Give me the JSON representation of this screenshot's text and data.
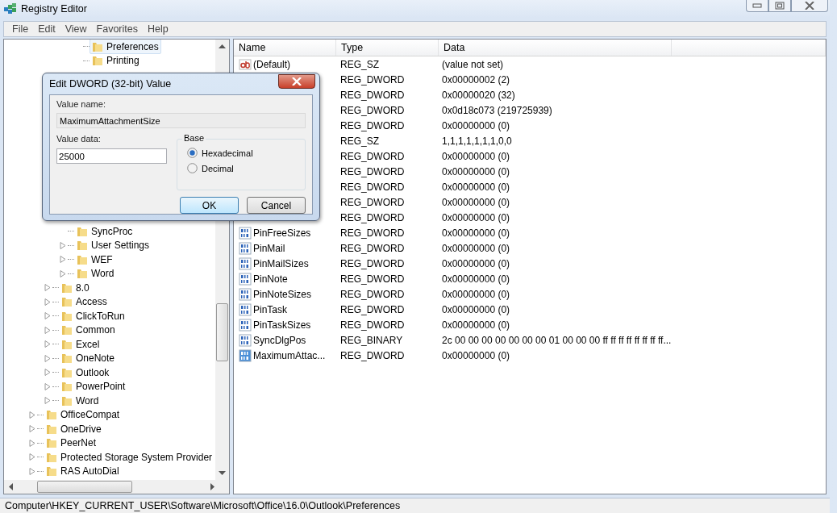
{
  "window": {
    "title": "Registry Editor"
  },
  "menu": [
    "File",
    "Edit",
    "View",
    "Favorites",
    "Help"
  ],
  "tree": {
    "items": [
      {
        "children": [
          {
            "children": [
              {
                "children": [
                  {
                    "label": "Preferences",
                    "selected": true,
                    "expandable": false
                  },
                  {
                    "label": "Printing",
                    "selected": false,
                    "expandable": false
                  }
                ]
              },
              {
                "label": "SyncProc",
                "selected": false,
                "expandable": false
              },
              {
                "label": "User Settings",
                "selected": false,
                "expandable": true
              },
              {
                "label": "WEF",
                "selected": false,
                "expandable": true
              },
              {
                "label": "Word",
                "selected": false,
                "expandable": true
              }
            ]
          },
          {
            "label": "8.0",
            "selected": false,
            "expandable": true
          },
          {
            "label": "Access",
            "selected": false,
            "expandable": true
          },
          {
            "label": "ClickToRun",
            "selected": false,
            "expandable": true
          },
          {
            "label": "Common",
            "selected": false,
            "expandable": true
          },
          {
            "label": "Excel",
            "selected": false,
            "expandable": true
          },
          {
            "label": "OneNote",
            "selected": false,
            "expandable": true
          },
          {
            "label": "Outlook",
            "selected": false,
            "expandable": true
          },
          {
            "label": "PowerPoint",
            "selected": false,
            "expandable": true
          },
          {
            "label": "Word",
            "selected": false,
            "expandable": true
          }
        ]
      },
      {
        "label": "OfficeCompat",
        "selected": false,
        "expandable": true
      },
      {
        "label": "OneDrive",
        "selected": false,
        "expandable": true
      },
      {
        "label": "PeerNet",
        "selected": false,
        "expandable": true
      },
      {
        "label": "Protected Storage System Provider",
        "selected": false,
        "expandable": true
      },
      {
        "label": "RAS AutoDial",
        "selected": false,
        "expandable": true
      }
    ]
  },
  "list": {
    "columns": [
      "Name",
      "Type",
      "Data"
    ],
    "rows": [
      {
        "name": "(Default)",
        "type": "REG_SZ",
        "data": "(value not set)",
        "kind": "string",
        "selected": false
      },
      {
        "type": "REG_DWORD",
        "data": "0x00000002 (2)"
      },
      {
        "type": "REG_DWORD",
        "data": "0x00000020 (32)"
      },
      {
        "type": "REG_DWORD",
        "data": "0x0d18c073 (219725939)"
      },
      {
        "type": "REG_DWORD",
        "data": "0x00000000 (0)"
      },
      {
        "type": "REG_SZ",
        "data": "1,1,1,1,1,1,1,0,0"
      },
      {
        "type": "REG_DWORD",
        "data": "0x00000000 (0)"
      },
      {
        "type": "REG_DWORD",
        "data": "0x00000000 (0)"
      },
      {
        "type": "REG_DWORD",
        "data": "0x00000000 (0)"
      },
      {
        "type": "REG_DWORD",
        "data": "0x00000000 (0)"
      },
      {
        "type": "REG_DWORD",
        "data": "0x00000000 (0)"
      },
      {
        "name": "PinFreeSizes",
        "type": "REG_DWORD",
        "data": "0x00000000 (0)",
        "kind": "binary",
        "selected": false
      },
      {
        "name": "PinMail",
        "type": "REG_DWORD",
        "data": "0x00000000 (0)",
        "kind": "binary",
        "selected": false
      },
      {
        "name": "PinMailSizes",
        "type": "REG_DWORD",
        "data": "0x00000000 (0)",
        "kind": "binary",
        "selected": false
      },
      {
        "name": "PinNote",
        "type": "REG_DWORD",
        "data": "0x00000000 (0)",
        "kind": "binary",
        "selected": false
      },
      {
        "name": "PinNoteSizes",
        "type": "REG_DWORD",
        "data": "0x00000000 (0)",
        "kind": "binary",
        "selected": false
      },
      {
        "name": "PinTask",
        "type": "REG_DWORD",
        "data": "0x00000000 (0)",
        "kind": "binary",
        "selected": false
      },
      {
        "name": "PinTaskSizes",
        "type": "REG_DWORD",
        "data": "0x00000000 (0)",
        "kind": "binary",
        "selected": false
      },
      {
        "name": "SyncDlgPos",
        "type": "REG_BINARY",
        "data": "2c 00 00 00 00 00 00 00 01 00 00 00 ff ff ff ff ff ff ff ff...",
        "kind": "binary",
        "selected": false
      },
      {
        "name": "MaximumAttac...",
        "type": "REG_DWORD",
        "data": "0x00000000 (0)",
        "kind": "binary",
        "selected": true
      }
    ]
  },
  "status_bar": "Computer\\HKEY_CURRENT_USER\\Software\\Microsoft\\Office\\16.0\\Outlook\\Preferences",
  "dialog": {
    "title": "Edit DWORD (32-bit) Value",
    "value_name_label": "Value name:",
    "value_name": "MaximumAttachmentSize",
    "value_data_label": "Value data:",
    "value_data": "25000",
    "base_label": "Base",
    "base_options": [
      {
        "label": "Hexadecimal",
        "selected": true
      },
      {
        "label": "Decimal",
        "selected": false
      }
    ],
    "buttons": [
      {
        "label": "OK",
        "default": true
      },
      {
        "label": "Cancel",
        "default": false
      }
    ]
  }
}
